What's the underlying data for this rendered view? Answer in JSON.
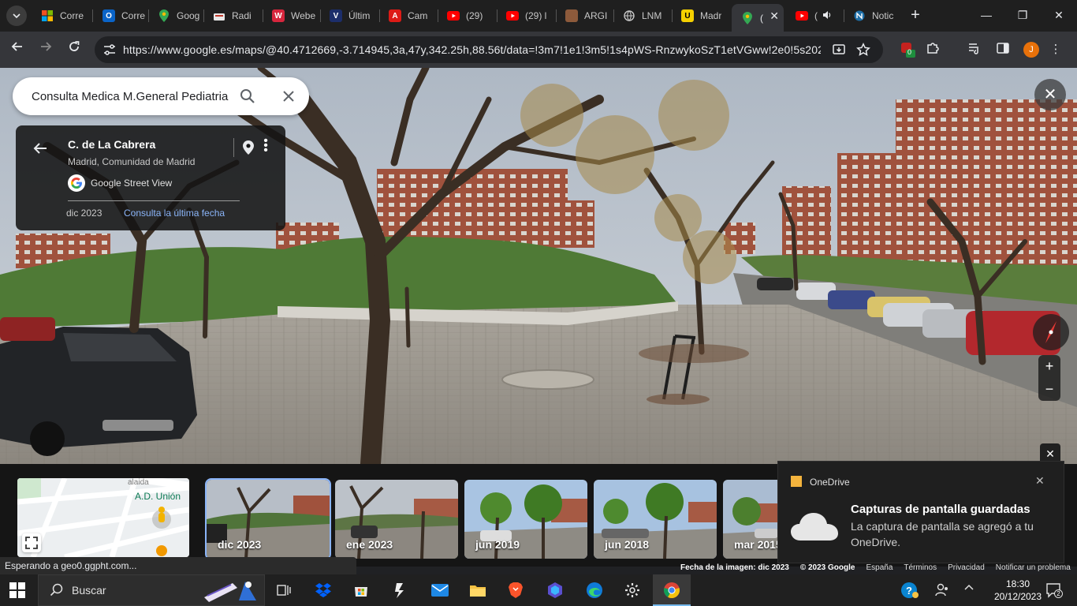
{
  "browser": {
    "tabs": [
      {
        "label": "Corre",
        "icon": "microsoft-icon"
      },
      {
        "label": "Corre",
        "icon": "outlook-icon"
      },
      {
        "label": "Goog",
        "icon": "maps-pin-icon"
      },
      {
        "label": "Radi",
        "icon": "radio-icon"
      },
      {
        "label": "Webe",
        "icon": "webex-icon"
      },
      {
        "label": "Últim",
        "icon": "v-logo-icon"
      },
      {
        "label": "Cam",
        "icon": "angular-a-icon"
      },
      {
        "label": "(29) ",
        "icon": "youtube-icon"
      },
      {
        "label": "(29) l",
        "icon": "youtube-icon"
      },
      {
        "label": "ARGI",
        "icon": "book-icon"
      },
      {
        "label": "LNM",
        "icon": "globe-icon"
      },
      {
        "label": "Madr",
        "icon": "u-logo-icon"
      },
      {
        "label": "(",
        "icon": "maps-pin-icon",
        "active": true
      },
      {
        "label": "(",
        "icon": "youtube-icon",
        "audio": true
      },
      {
        "label": "Notic",
        "icon": "news-icon"
      }
    ],
    "url": "https://www.google.es/maps/@40.4712669,-3.714945,3a,47y,342.25h,88.56t/data=!3m7!1e1!3m5!1s4pWS-RnzwykoSzT1etVGww!2e0!5s202312...",
    "extension_badge": "0",
    "profile_initial": "J"
  },
  "maps": {
    "search_query": "Consulta Medica M.General Pediatria",
    "place": {
      "title": "C. de La Cabrera",
      "subtitle": "Madrid, Comunidad de Madrid",
      "source": "Google Street View",
      "capture_date": "dic 2023",
      "latest_link": "Consulta la última fecha"
    },
    "minimap_label": "A.D. Unión",
    "timeline": [
      {
        "label": "dic 2023",
        "selected": true
      },
      {
        "label": "ene 2023"
      },
      {
        "label": "jun 2019"
      },
      {
        "label": "jun 2018"
      },
      {
        "label": "mar 2015"
      }
    ],
    "footer": {
      "status": "Esperando a geo0.ggpht.com...",
      "image_date": "Fecha de la imagen: dic 2023",
      "copyright": "© 2023 Google",
      "links": [
        "España",
        "Términos",
        "Privacidad",
        "Notificar un problema"
      ]
    }
  },
  "toast": {
    "app": "OneDrive",
    "title": "Capturas de pantalla guardadas",
    "body": "La captura de pantalla se agregó a tu OneDrive."
  },
  "taskbar": {
    "search_label": "Buscar",
    "time": "18:30",
    "date": "20/12/2023",
    "notification_count": "2"
  },
  "colors": {
    "accent_link": "#8ab4f8",
    "sky": "#b9c1cc",
    "brick": "#a0523d"
  }
}
